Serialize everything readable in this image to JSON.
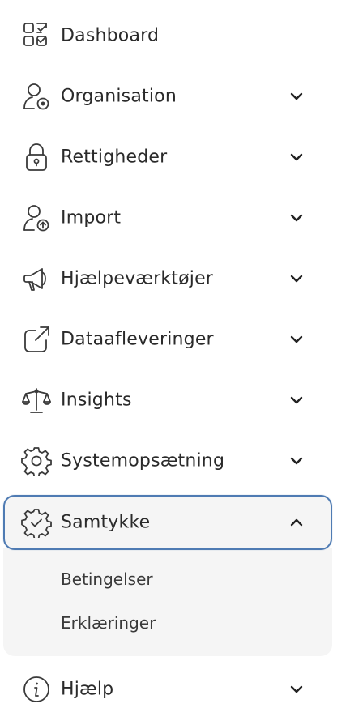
{
  "nav": {
    "items": [
      {
        "label": "Dashboard",
        "icon": "dashboard-icon"
      },
      {
        "label": "Organisation",
        "icon": "user-settings-icon"
      },
      {
        "label": "Rettigheder",
        "icon": "lock-icon"
      },
      {
        "label": "Import",
        "icon": "user-upload-icon"
      },
      {
        "label": "Hjælpeværktøjer",
        "icon": "megaphone-icon"
      },
      {
        "label": "Dataafleveringer",
        "icon": "external-link-icon"
      },
      {
        "label": "Insights",
        "icon": "scale-icon"
      },
      {
        "label": "Systemopsætning",
        "icon": "gear-icon"
      },
      {
        "label": "Samtykke",
        "icon": "verified-badge-icon",
        "expanded": true
      },
      {
        "label": "Hjælp",
        "icon": "info-icon"
      }
    ],
    "submenu": [
      "Betingelser",
      "Erklæringer"
    ]
  },
  "colors": {
    "active_border": "#4f7bb3",
    "submenu_bg": "#f5f5f5",
    "text": "#2a2a2a"
  }
}
